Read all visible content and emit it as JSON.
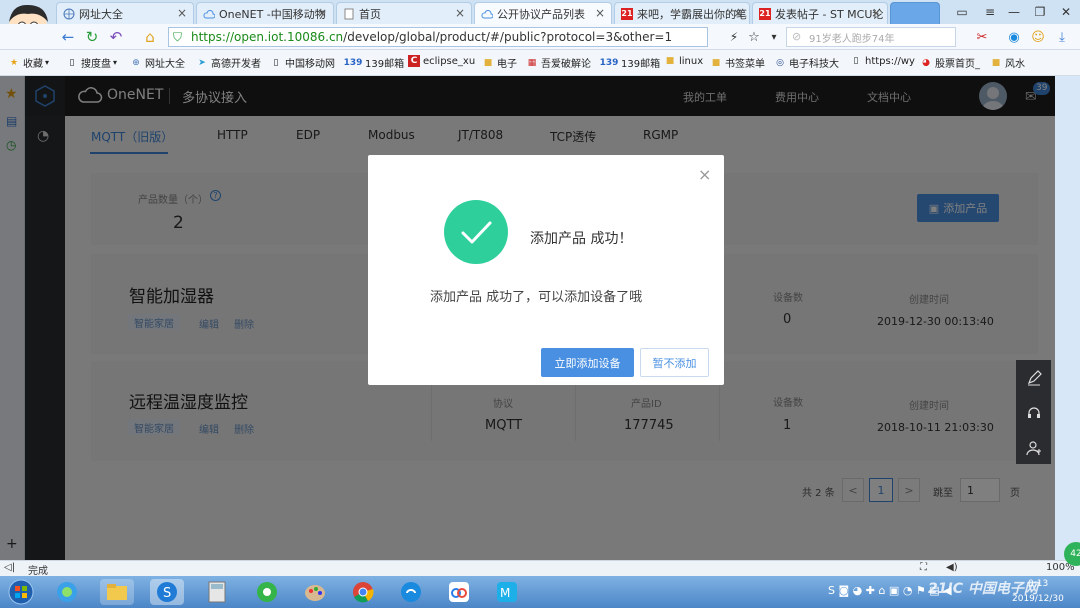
{
  "browser": {
    "tabs": [
      {
        "label": "网址大全",
        "icon": "globe-icon"
      },
      {
        "label": "OneNET -中国移动物",
        "icon": "cloud-icon"
      },
      {
        "label": "首页",
        "icon": "page-icon"
      },
      {
        "label": "公开协议产品列表",
        "icon": "cloud-icon"
      },
      {
        "label": "来吧，学霸展出你的笔",
        "icon": "badge-21-icon"
      },
      {
        "label": "发表帖子 - ST MCU论",
        "icon": "badge-21-icon"
      }
    ],
    "url": "https://open.iot.10086.cn/develop/global/product/#/public?protocol=3&other=1",
    "url_host": "https://open.iot.10086.cn",
    "url_path": "/develop/global/product/#/public?protocol=3&other=1",
    "search_placeholder": "91岁老人跑步74年",
    "badge_21": "21",
    "favorites": [
      {
        "label": "收藏",
        "icon": "star-icon"
      },
      {
        "label": "搜度盘",
        "icon": "page-icon"
      },
      {
        "label": "网址大全",
        "icon": "globe-icon"
      },
      {
        "label": "高德开发者",
        "icon": "map-icon"
      },
      {
        "label": "中国移动网",
        "icon": "page-icon"
      },
      {
        "label": "139邮箱",
        "icon": "mail-139-icon"
      },
      {
        "label": "eclipse_xu",
        "icon": "c-logo-icon"
      },
      {
        "label": "电子",
        "icon": "folder-icon"
      },
      {
        "label": "吾爱破解论",
        "icon": "grid-icon"
      },
      {
        "label": "139邮箱",
        "icon": "mail-139-icon"
      },
      {
        "label": "linux",
        "icon": "folder-icon"
      },
      {
        "label": "书签菜单",
        "icon": "folder-icon"
      },
      {
        "label": "电子科技大",
        "icon": "emblem-icon"
      },
      {
        "label": "https://wy",
        "icon": "page-icon"
      },
      {
        "label": "股票首页_",
        "icon": "weibo-icon"
      },
      {
        "label": "风水",
        "icon": "folder-icon"
      }
    ],
    "status_text": "完成",
    "zoom": "100%"
  },
  "app": {
    "logo": "OneNET",
    "section": "多协议接入",
    "nav": [
      "我的工单",
      "费用中心",
      "文档中心"
    ],
    "mail_count": "39",
    "protocol_tabs": [
      "MQTT（旧版）",
      "HTTP",
      "EDP",
      "Modbus",
      "JT/T808",
      "TCP透传",
      "RGMP"
    ],
    "summary": {
      "count_label": "产品数量（个）",
      "count_value": "2",
      "add_button": "添加产品"
    },
    "products": [
      {
        "name": "智能加湿器",
        "tag": "智能家居",
        "edit": "编辑",
        "delete": "删除",
        "device_label": "设备数",
        "device_count": "0",
        "created_label": "创建时间",
        "created": "2019-12-30 00:13:40"
      },
      {
        "name": "远程温湿度监控",
        "tag": "智能家居",
        "edit": "编辑",
        "delete": "删除",
        "protocol_label": "协议",
        "protocol": "MQTT",
        "product_id_label": "产品ID",
        "product_id": "177745",
        "device_label": "设备数",
        "device_count": "1",
        "created_label": "创建时间",
        "created": "2018-10-11 21:03:30"
      }
    ],
    "pagination": {
      "total": "共 2 条",
      "prev": "<",
      "current": "1",
      "next": ">",
      "goto_label": "跳至",
      "goto_value": "1",
      "page_unit": "页"
    }
  },
  "modal": {
    "title": "添加产品 成功！",
    "message": "添加产品 成功了，可以添加设备了哦",
    "primary_button": "立即添加设备",
    "secondary_button": "暂不添加",
    "close": "×"
  },
  "taskbar": {
    "time": "0:13",
    "date": "2019/12/30",
    "watermark": "21IC 中国电子网",
    "corner_badge": "42"
  },
  "colors": {
    "accent": "#3f86d9",
    "success": "#2fcf9b",
    "primary_button": "#4a90e2",
    "dark_nav": "#1e1f21"
  }
}
